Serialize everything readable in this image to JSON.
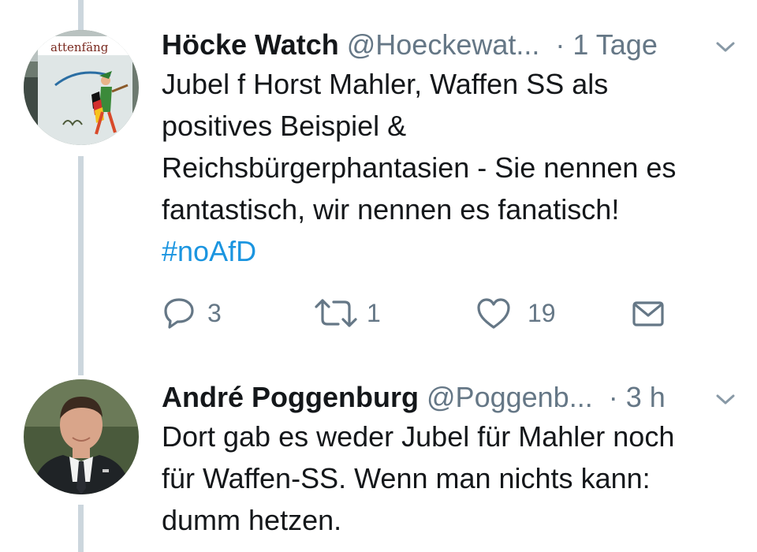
{
  "tweets": [
    {
      "name": "Höcke Watch",
      "handle": "@Hoeckewat...",
      "separator": "·",
      "time": "1 Tage",
      "avatar": {
        "icon": "avatar-pied-piper-poster",
        "sign_text": "attenfäng"
      },
      "lines": [
        "Jubel f Horst Mahler, Waffen SS als",
        "positives Beispiel &",
        "Reichsbürgerphantasien - Sie nennen es",
        "fantastisch, wir nennen es fanatisch!"
      ],
      "hashtag": "#noAfD",
      "actions": {
        "replies": "3",
        "retweets": "1",
        "likes": "19"
      }
    },
    {
      "name": "André Poggenburg",
      "handle": "@Poggenb...",
      "separator": "·",
      "time": "3 h",
      "avatar": {
        "icon": "avatar-portrait-photo"
      },
      "lines": [
        "Dort gab es weder Jubel für Mahler noch",
        "für Waffen-SS. Wenn man nichts kann:",
        "dumm hetzen."
      ]
    }
  ],
  "colors": {
    "text": "#14171a",
    "secondary": "#657786",
    "link": "#1b95e0",
    "thread_line": "#ccd6dd"
  },
  "icons": {
    "reply": "reply-icon",
    "retweet": "retweet-icon",
    "like": "heart-icon",
    "dm": "envelope-icon",
    "more": "chevron-down-icon"
  }
}
